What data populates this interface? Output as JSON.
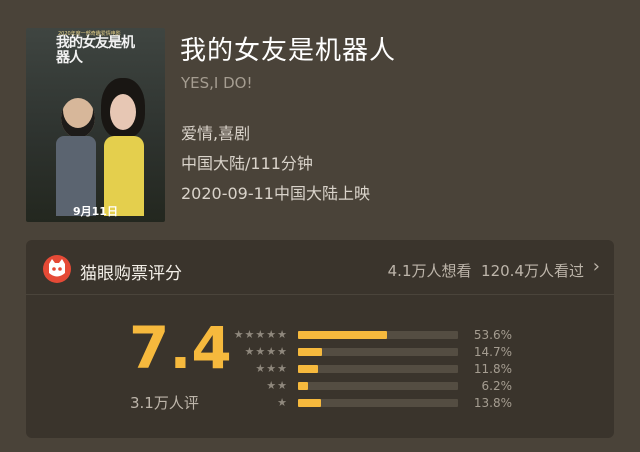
{
  "movie": {
    "title": "我的女友是机器人",
    "english_title": "YES,I DO!",
    "genres": "爱情,喜剧",
    "region_duration": "中国大陆/111分钟",
    "release": "2020-09-11中国大陆上映",
    "poster": {
      "title_text": "我的女友是机器人",
      "tagline": "2020年度一部奇趣爱情电影",
      "date_text": "9月11日"
    }
  },
  "rating": {
    "source_label": "猫眼购票评分",
    "want_to_see": "4.1万人想看",
    "watched": "120.4万人看过",
    "score": "7.4",
    "raters": "3.1万人评",
    "distribution": [
      {
        "stars": "★★★★★",
        "percent": 53.6,
        "label": "53.6%"
      },
      {
        "stars": "★★★★",
        "percent": 14.7,
        "label": "14.7%"
      },
      {
        "stars": "★★★",
        "percent": 11.8,
        "label": "11.8%"
      },
      {
        "stars": "★★",
        "percent": 6.2,
        "label": "6.2%"
      },
      {
        "stars": "★",
        "percent": 13.8,
        "label": "13.8%"
      }
    ]
  },
  "colors": {
    "accent": "#f6b93d",
    "background": "#4a4339",
    "card": "#3a342c",
    "logo": "#e54a36"
  },
  "icons": {
    "source_logo": "maoyan-cat-icon",
    "more": "chevron-right-icon"
  }
}
